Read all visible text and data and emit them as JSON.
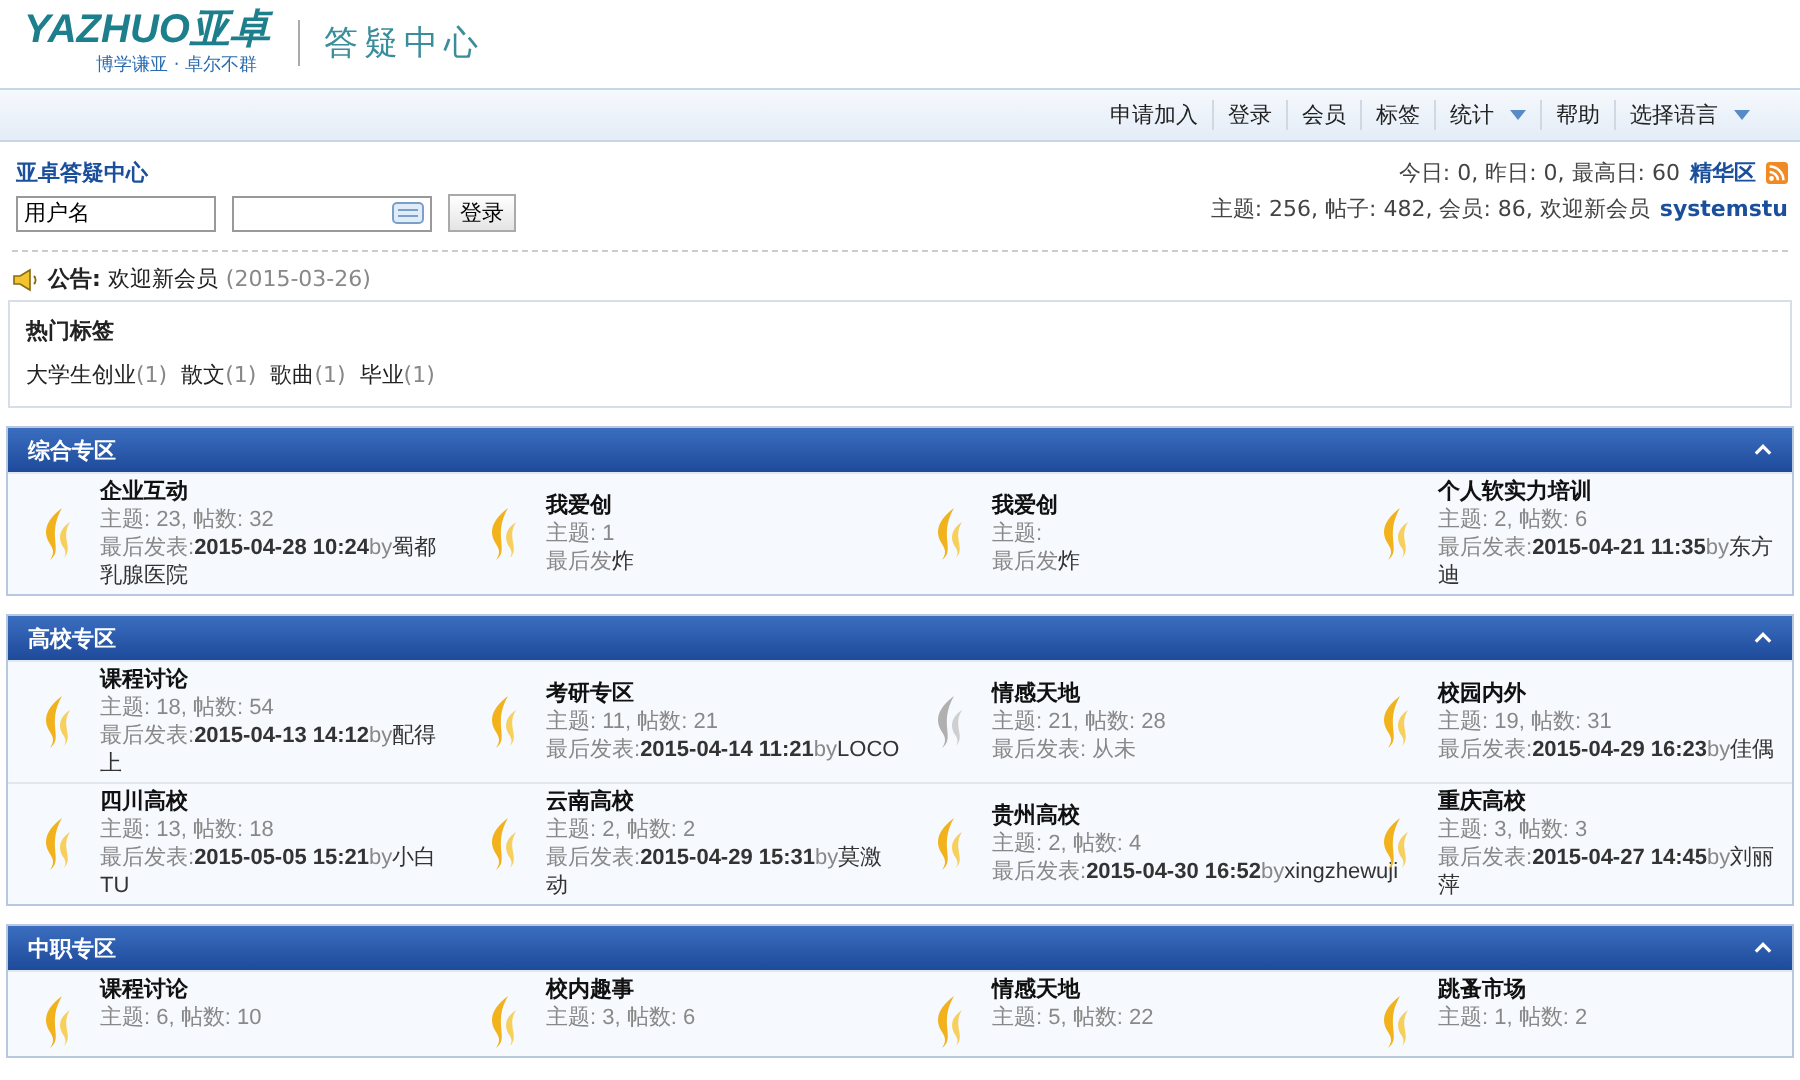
{
  "header": {
    "logo": "YAZHUO亚卓",
    "slogan": "博学谦亚 · 卓尔不群",
    "site_title": "答疑中心"
  },
  "nav": [
    {
      "label": "申请加入",
      "has_menu": false
    },
    {
      "label": "登录",
      "has_menu": false
    },
    {
      "label": "会员",
      "has_menu": false
    },
    {
      "label": "标签",
      "has_menu": false
    },
    {
      "label": "统计",
      "has_menu": true
    },
    {
      "label": "帮助",
      "has_menu": false
    },
    {
      "label": "选择语言",
      "has_menu": true
    }
  ],
  "login": {
    "title": "亚卓答疑中心",
    "username": "用户名",
    "button": "登录"
  },
  "stats": {
    "line_1": "今日: 0, 昨日: 0, 最高日: 60",
    "digest_link": "精华区",
    "line_2": "主题: 256, 帖子: 482, 会员: 86, 欢迎新会员",
    "new_member": "systemstu"
  },
  "announcement": {
    "text": "**公告:** 欢迎新会员",
    "date": "(2015-03-26)"
  },
  "hot_tags": {
    "title": "热门标签",
    "tags": [
      {
        "name": "大学生创业",
        "count": "(1)"
      },
      {
        "name": "散文",
        "count": "(1)"
      },
      {
        "name": "歌曲",
        "count": "(1)"
      },
      {
        "name": "毕业",
        "count": "(1)"
      }
    ]
  },
  "sections": [
    {
      "title": "综合专区",
      "expanded": true,
      "forums": [
        {
          "title": "企业互动",
          "stats": "主题: 23, 帖数: 32",
          "last_label": "最后发表:",
          "last_time": "2015-04-28 10:24",
          "by": "by",
          "author": "蜀都乳腺医院",
          "new": true
        },
        {
          "title": "我爱创",
          "stats": "主题: 1",
          "last_label": "最后发",
          "author": "炸",
          "new": true
        },
        {
          "title": "我爱创",
          "stats": "主题:",
          "last_label": "最后发",
          "author": "炸",
          "new": true
        },
        {
          "title": "个人软实力培训",
          "stats": "主题: 2, 帖数: 6",
          "last_label": "最后发表:",
          "last_time": "2015-04-21 11:35",
          "by": "by",
          "author": "东方迪",
          "new": true
        }
      ]
    },
    {
      "title": "高校专区",
      "expanded": true,
      "forums": [
        {
          "title": "课程讨论",
          "stats": "主题: 18, 帖数: 54",
          "last_label": "最后发表:",
          "last_time": "2015-04-13 14:12",
          "by": "by",
          "author": "配得上",
          "new": true
        },
        {
          "title": "考研专区",
          "stats": "主题: 11, 帖数: 21",
          "last_label": "最后发表:",
          "last_time": "2015-04-14 11:21",
          "by": "by",
          "author": "LOCO",
          "new": true
        },
        {
          "title": "情感天地",
          "stats": "主题: 21, 帖数: 28",
          "last_label": "最后发表: 从未",
          "new": false
        },
        {
          "title": "校园内外",
          "stats": "主题: 19, 帖数: 31",
          "last_label": "最后发表:",
          "last_time": "2015-04-29 16:23",
          "by": "by",
          "author": "佳偶",
          "new": true
        },
        {
          "title": "四川高校",
          "stats": "主题: 13, 帖数: 18",
          "last_label": "最后发表:",
          "last_time": "2015-05-05 15:21",
          "by": "by",
          "author": "小白TU",
          "new": true
        },
        {
          "title": "云南高校",
          "stats": "主题: 2, 帖数: 2",
          "last_label": "最后发表:",
          "last_time": "2015-04-29 15:31",
          "by": "by",
          "author": "莫激动",
          "new": true
        },
        {
          "title": "贵州高校",
          "stats": "主题: 2, 帖数: 4",
          "last_label": "最后发表:",
          "last_time": "2015-04-30 16:52",
          "by": "by",
          "author": "xingzhewuji",
          "new": true
        },
        {
          "title": "重庆高校",
          "stats": "主题: 3, 帖数: 3",
          "last_label": "最后发表:",
          "last_time": "2015-04-27 14:45",
          "by": "by",
          "author": "刘丽萍",
          "new": true
        }
      ]
    },
    {
      "title": "中职专区",
      "expanded": true,
      "forums": [
        {
          "title": "课程讨论",
          "stats": "主题: 6, 帖数: 10",
          "new": true
        },
        {
          "title": "校内趣事",
          "stats": "主题: 3, 帖数: 6",
          "new": true
        },
        {
          "title": "情感天地",
          "stats": "主题: 5, 帖数: 22",
          "new": true
        },
        {
          "title": "跳蚤市场",
          "stats": "主题: 1, 帖数: 2",
          "new": true
        }
      ]
    }
  ]
}
